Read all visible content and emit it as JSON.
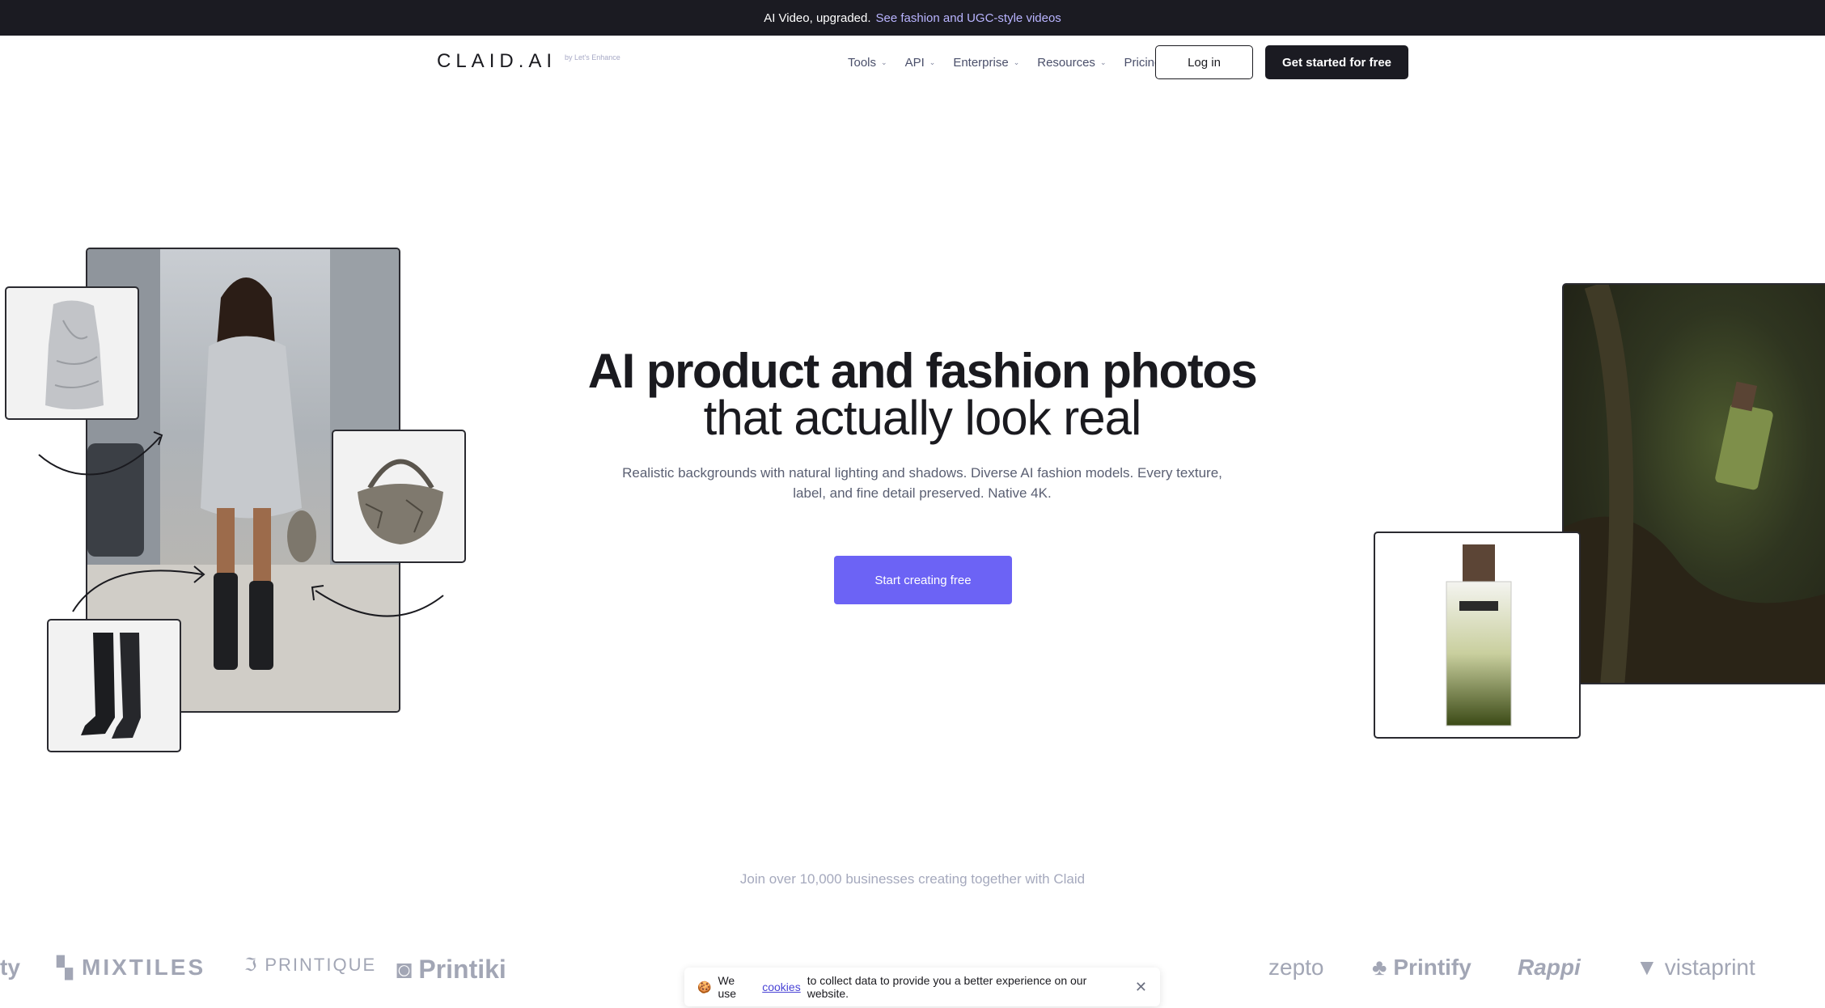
{
  "announcement": {
    "text": "AI Video, upgraded.",
    "link": "See fashion and UGC-style videos"
  },
  "header": {
    "logo": "CLAID.AI",
    "logo_sub": "by Let's Enhance",
    "nav": [
      {
        "label": "Tools",
        "dropdown": true
      },
      {
        "label": "API",
        "dropdown": true
      },
      {
        "label": "Enterprise",
        "dropdown": true
      },
      {
        "label": "Resources",
        "dropdown": true
      },
      {
        "label": "Pricing",
        "dropdown": false
      }
    ],
    "login": "Log in",
    "get_started": "Get started for free"
  },
  "hero": {
    "title_bold": "AI product and fashion photos",
    "title_regular": "that actually look real",
    "subtitle": "Realistic backgrounds with natural lighting and shadows. Diverse AI fashion models. Every texture, label, and fine detail preserved. Native 4K.",
    "cta": "Start creating free"
  },
  "social_proof": {
    "text": "Join over 10,000 businesses creating together with Claid",
    "logos": [
      "ty",
      "MIXTILES",
      "PRINTIQUE",
      "Printiki",
      "zepto",
      "Printify",
      "Rappi",
      "vistaprint"
    ]
  },
  "cookie": {
    "prefix": "We use",
    "link": "cookies",
    "suffix": "to collect data to provide you a better experience on our website.",
    "icon": "🍪"
  },
  "colors": {
    "accent": "#6c63f5",
    "dark": "#1b1b22",
    "link_on_dark": "#b9b4ff"
  }
}
